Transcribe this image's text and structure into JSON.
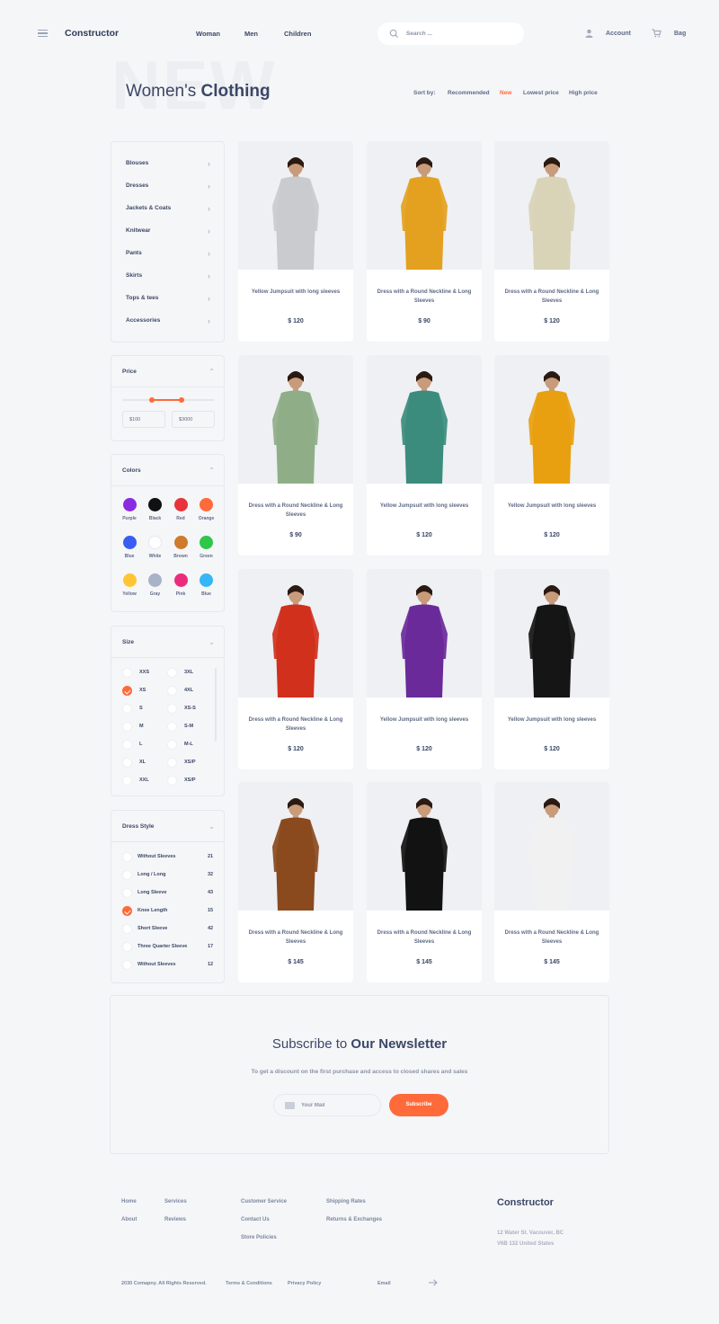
{
  "header": {
    "brand": "Constructor",
    "nav": [
      "Woman",
      "Men",
      "Children"
    ],
    "search_placeholder": "Search ...",
    "account_label": "Account",
    "bag_label": "Bag"
  },
  "title": {
    "background_word": "NEW",
    "title_light": "Women's",
    "title_bold": "Clothing"
  },
  "sort": {
    "label": "Sort by:",
    "options": [
      "Recommended",
      "New",
      "Lowest price",
      "High price"
    ],
    "active": "New"
  },
  "categories": [
    "Blouses",
    "Dresses",
    "Jackets & Coats",
    "Knitwear",
    "Pants",
    "Skirts",
    "Tops & tees",
    "Accessories"
  ],
  "price": {
    "title": "Price",
    "min_value": "$100",
    "max_value": "$3000",
    "range_fraction": [
      0.32,
      0.65
    ]
  },
  "colors": {
    "title": "Colors",
    "items": [
      {
        "name": "Purple",
        "hex": "#8a2be2"
      },
      {
        "name": "Black",
        "hex": "#111111"
      },
      {
        "name": "Red",
        "hex": "#e8333a"
      },
      {
        "name": "Orange",
        "hex": "#ff6a3a"
      },
      {
        "name": "Blue",
        "hex": "#3a5cf5"
      },
      {
        "name": "White",
        "hex": "#ffffff"
      },
      {
        "name": "Brown",
        "hex": "#d07a2c"
      },
      {
        "name": "Green",
        "hex": "#2fc64a"
      },
      {
        "name": "Yellow",
        "hex": "#ffc533"
      },
      {
        "name": "Gray",
        "hex": "#a9b2c6"
      },
      {
        "name": "Pink",
        "hex": "#ea2c7c"
      },
      {
        "name": "Blue",
        "hex": "#35b6f6"
      }
    ]
  },
  "size": {
    "title": "Size",
    "left": [
      "XXS",
      "XS",
      "S",
      "M",
      "L",
      "XL",
      "XXL"
    ],
    "right": [
      "3XL",
      "4XL",
      "XS-S",
      "S-M",
      "M-L",
      "XS/P",
      "XS/P"
    ],
    "selected": "XS"
  },
  "dress_style": {
    "title": "Dress Style",
    "items": [
      {
        "label": "Without Sleeves",
        "count": "21",
        "checked": false
      },
      {
        "label": "Long / Long",
        "count": "32",
        "checked": false
      },
      {
        "label": "Long Sleeve",
        "count": "43",
        "checked": false
      },
      {
        "label": "Knee Length",
        "count": "15",
        "checked": true
      },
      {
        "label": "Short Sleeve",
        "count": "42",
        "checked": false
      },
      {
        "label": "Three Quarter Sleeve",
        "count": "17",
        "checked": false
      },
      {
        "label": "Without Sleeves",
        "count": "12",
        "checked": false
      }
    ]
  },
  "products": [
    {
      "name": "Yellow Jumpsuit with long sleeves",
      "price": "$ 120",
      "garment": "#c9cbce"
    },
    {
      "name": "Dress with a Round Neckline & Long Sleeves",
      "price": "$ 90",
      "garment": "#e3a11f"
    },
    {
      "name": "Dress with a Round Neckline & Long Sleeves",
      "price": "$ 120",
      "garment": "#d9d3b8"
    },
    {
      "name": "Dress with a Round Neckline & Long Sleeves",
      "price": "$ 90",
      "garment": "#8fae88"
    },
    {
      "name": "Yellow Jumpsuit with long sleeves",
      "price": "$ 120",
      "garment": "#3b8c7d"
    },
    {
      "name": "Yellow Jumpsuit with long sleeves",
      "price": "$ 120",
      "garment": "#e8a010"
    },
    {
      "name": "Dress with a Round Neckline & Long Sleeves",
      "price": "$ 120",
      "garment": "#d1301c"
    },
    {
      "name": "Yellow Jumpsuit with long sleeves",
      "price": "$ 120",
      "garment": "#6a2a9a"
    },
    {
      "name": "Yellow Jumpsuit with long sleeves",
      "price": "$ 120",
      "garment": "#151515"
    },
    {
      "name": "Dress with a Round Neckline & Long Sleeves",
      "price": "$ 145",
      "garment": "#8a4a1e"
    },
    {
      "name": "Dress with a Round Neckline & Long Sleeves",
      "price": "$ 145",
      "garment": "#121212"
    },
    {
      "name": "Dress with a Round Neckline & Long Sleeves",
      "price": "$ 145",
      "garment": "#f1f1f1"
    }
  ],
  "newsletter": {
    "title_light": "Subscribe to",
    "title_bold": "Our Newsletter",
    "subtitle": "To get a discount on the first purchase and access to closed shares and sales",
    "input_placeholder": "Your Mail",
    "button": "Subscribe"
  },
  "footer": {
    "col1": [
      "Home",
      "About"
    ],
    "col2": [
      "Services",
      "Reviews"
    ],
    "col3": [
      "Customer Service",
      "Contact Us",
      "Store Policies"
    ],
    "col4": [
      "Shipping Rates",
      "Returns & Exchanges"
    ],
    "brand": "Constructor",
    "address": [
      "12 Water St. Vacouver, BC",
      "V6B 132 United States"
    ],
    "copyright": "2030 Comapny. All Rights Reserved.",
    "terms": "Terms & Conditions",
    "privacy": "Privacy Policy",
    "email_label": "Email"
  },
  "accent_color": "#ff6a3a"
}
